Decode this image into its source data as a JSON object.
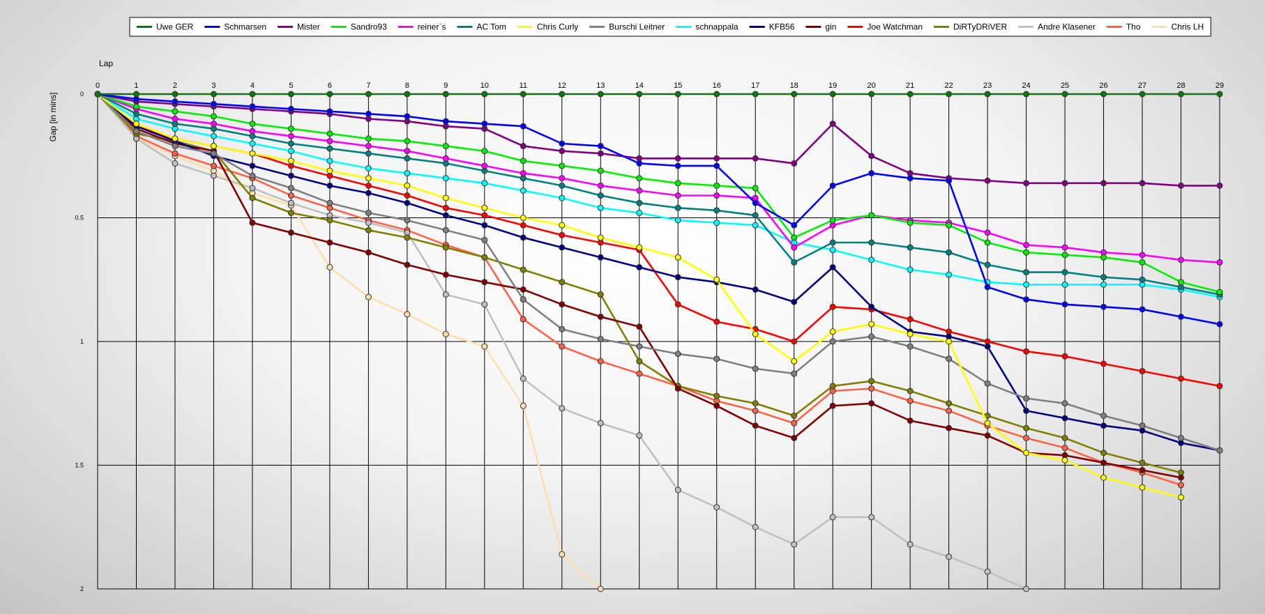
{
  "chart_data": {
    "type": "line",
    "title": "",
    "xlabel": "Lap",
    "ylabel": "Gap [in mins]",
    "x": [
      0,
      1,
      2,
      3,
      4,
      5,
      6,
      7,
      8,
      9,
      10,
      11,
      12,
      13,
      14,
      15,
      16,
      17,
      18,
      19,
      20,
      21,
      22,
      23,
      24,
      25,
      26,
      27,
      28,
      29
    ],
    "xlim": [
      0,
      29
    ],
    "ylim": [
      0,
      2
    ],
    "y_inverted": true,
    "yticks": [
      "0",
      "0.5",
      "1",
      "1.5",
      "2"
    ],
    "ytick_values": [
      0,
      0.5,
      1,
      1.5,
      2
    ],
    "grid": "vertical at every lap, horizontal at 0, 0.5, 1, 1.5, 2",
    "legend_position": "top",
    "series": [
      {
        "name": "Uwe GER",
        "color": "#0b7a0b",
        "values": [
          0,
          0,
          0,
          0,
          0,
          0,
          0,
          0,
          0,
          0,
          0,
          0,
          0,
          0,
          0,
          0,
          0,
          0,
          0,
          0,
          0,
          0,
          0,
          0,
          0,
          0,
          0,
          0,
          0,
          0
        ]
      },
      {
        "name": "Schmarsen",
        "color": "#0000ff",
        "values": [
          0,
          0.02,
          0.03,
          0.04,
          0.05,
          0.06,
          0.07,
          0.08,
          0.09,
          0.11,
          0.12,
          0.13,
          0.2,
          0.21,
          0.28,
          0.29,
          0.29,
          0.44,
          0.53,
          0.37,
          0.32,
          0.34,
          0.35,
          0.78,
          0.83,
          0.85,
          0.86,
          0.87,
          0.9,
          0.93
        ]
      },
      {
        "name": "Mister",
        "color": "#800080",
        "values": [
          0,
          0.03,
          0.04,
          0.05,
          0.06,
          0.07,
          0.08,
          0.1,
          0.11,
          0.13,
          0.14,
          0.21,
          0.23,
          0.24,
          0.26,
          0.26,
          0.26,
          0.26,
          0.28,
          0.12,
          0.25,
          0.32,
          0.34,
          0.35,
          0.36,
          0.36,
          0.36,
          0.36,
          0.37,
          0.37
        ]
      },
      {
        "name": "Sandro93",
        "color": "#00ee00",
        "values": [
          0,
          0.05,
          0.07,
          0.09,
          0.12,
          0.14,
          0.16,
          0.18,
          0.19,
          0.21,
          0.23,
          0.27,
          0.29,
          0.31,
          0.34,
          0.36,
          0.37,
          0.38,
          0.58,
          0.51,
          0.49,
          0.52,
          0.53,
          0.6,
          0.64,
          0.65,
          0.66,
          0.68,
          0.76,
          0.8
        ]
      },
      {
        "name": "reiner`s",
        "color": "#ff00ff",
        "values": [
          0,
          0.06,
          0.1,
          0.12,
          0.15,
          0.17,
          0.19,
          0.21,
          0.23,
          0.26,
          0.29,
          0.32,
          0.34,
          0.37,
          0.39,
          0.41,
          0.41,
          0.42,
          0.62,
          0.53,
          0.49,
          0.51,
          0.52,
          0.56,
          0.61,
          0.62,
          0.64,
          0.65,
          0.67,
          0.68
        ]
      },
      {
        "name": "AC Tom",
        "color": "#008080",
        "values": [
          0,
          0.08,
          0.12,
          0.14,
          0.17,
          0.2,
          0.22,
          0.24,
          0.26,
          0.28,
          0.31,
          0.34,
          0.37,
          0.41,
          0.44,
          0.46,
          0.47,
          0.49,
          0.68,
          0.6,
          0.6,
          0.62,
          0.64,
          0.69,
          0.72,
          0.72,
          0.74,
          0.75,
          0.78,
          0.81
        ]
      },
      {
        "name": "Chris Curly",
        "color": "#ffff00",
        "values": [
          0,
          0.12,
          0.18,
          0.21,
          0.24,
          0.27,
          0.31,
          0.34,
          0.37,
          0.42,
          0.46,
          0.5,
          0.53,
          0.58,
          0.62,
          0.66,
          0.75,
          0.97,
          1.08,
          0.96,
          0.93,
          0.97,
          1.0,
          1.33,
          1.45,
          1.48,
          1.55,
          1.59,
          1.63,
          null
        ]
      },
      {
        "name": "Burschi Leitner",
        "color": "#808080",
        "values": [
          0,
          0.15,
          0.21,
          0.24,
          0.33,
          0.38,
          0.44,
          0.48,
          0.51,
          0.55,
          0.59,
          0.83,
          0.95,
          0.99,
          1.02,
          1.05,
          1.07,
          1.11,
          1.13,
          1.0,
          0.98,
          1.02,
          1.07,
          1.17,
          1.23,
          1.25,
          1.3,
          1.34,
          1.39,
          1.44
        ]
      },
      {
        "name": "schnappala",
        "color": "#00ffff",
        "values": [
          0,
          0.1,
          0.14,
          0.17,
          0.2,
          0.23,
          0.27,
          0.3,
          0.32,
          0.34,
          0.36,
          0.39,
          0.42,
          0.46,
          0.48,
          0.51,
          0.52,
          0.53,
          0.6,
          0.63,
          0.67,
          0.71,
          0.73,
          0.76,
          0.77,
          0.77,
          0.77,
          0.77,
          0.79,
          0.82
        ]
      },
      {
        "name": "KFB56",
        "color": "#000080",
        "values": [
          0,
          0.13,
          0.19,
          0.25,
          0.29,
          0.33,
          0.37,
          0.4,
          0.44,
          0.49,
          0.53,
          0.58,
          0.62,
          0.66,
          0.7,
          0.74,
          0.76,
          0.79,
          0.84,
          0.7,
          0.86,
          0.96,
          0.98,
          1.02,
          1.28,
          1.31,
          1.34,
          1.36,
          1.41,
          1.44
        ]
      },
      {
        "name": "gin",
        "color": "#800000",
        "values": [
          0,
          0.14,
          0.2,
          0.23,
          0.52,
          0.56,
          0.6,
          0.64,
          0.69,
          0.73,
          0.76,
          0.79,
          0.85,
          0.9,
          0.94,
          1.19,
          1.26,
          1.34,
          1.39,
          1.26,
          1.25,
          1.32,
          1.35,
          1.38,
          1.45,
          1.46,
          1.49,
          1.52,
          1.55,
          null
        ]
      },
      {
        "name": "Joe Watchman",
        "color": "#ff0000",
        "values": [
          0,
          0.13,
          0.18,
          0.21,
          0.24,
          0.29,
          0.33,
          0.37,
          0.41,
          0.46,
          0.49,
          0.53,
          0.57,
          0.6,
          0.63,
          0.85,
          0.92,
          0.95,
          1.0,
          0.86,
          0.87,
          0.91,
          0.96,
          1.0,
          1.04,
          1.06,
          1.09,
          1.12,
          1.15,
          1.18
        ]
      },
      {
        "name": "DiRTyDRiVER",
        "color": "#808000",
        "values": [
          0,
          0.16,
          0.19,
          0.23,
          0.42,
          0.48,
          0.51,
          0.55,
          0.58,
          0.62,
          0.66,
          0.71,
          0.76,
          0.81,
          1.08,
          1.18,
          1.22,
          1.25,
          1.3,
          1.18,
          1.16,
          1.2,
          1.25,
          1.3,
          1.35,
          1.39,
          1.45,
          1.49,
          1.53,
          null
        ]
      },
      {
        "name": "Andre Klasener",
        "color": "#c0c0c0",
        "values": [
          0,
          0.18,
          0.28,
          0.33,
          0.38,
          0.44,
          0.49,
          0.52,
          0.56,
          0.81,
          0.85,
          1.15,
          1.27,
          1.33,
          1.38,
          1.6,
          1.67,
          1.75,
          1.82,
          1.71,
          1.71,
          1.82,
          1.87,
          1.93,
          2.0,
          null,
          null,
          null,
          null,
          null
        ]
      },
      {
        "name": "Tho",
        "color": "#ff6347",
        "values": [
          0,
          0.17,
          0.24,
          0.29,
          0.34,
          0.41,
          0.46,
          0.51,
          0.55,
          0.61,
          0.66,
          0.91,
          1.02,
          1.08,
          1.13,
          1.18,
          1.24,
          1.28,
          1.33,
          1.2,
          1.19,
          1.24,
          1.28,
          1.34,
          1.39,
          1.43,
          1.49,
          1.53,
          1.58,
          null
        ]
      },
      {
        "name": "Chris LH",
        "color": "#ffdead",
        "values": [
          0,
          0.18,
          0.25,
          0.31,
          0.4,
          0.45,
          0.7,
          0.82,
          0.89,
          0.97,
          1.02,
          1.26,
          1.86,
          2.0,
          null,
          null,
          null,
          null,
          null,
          null,
          null,
          null,
          null,
          null,
          null,
          null,
          null,
          null,
          null,
          null
        ]
      }
    ]
  }
}
